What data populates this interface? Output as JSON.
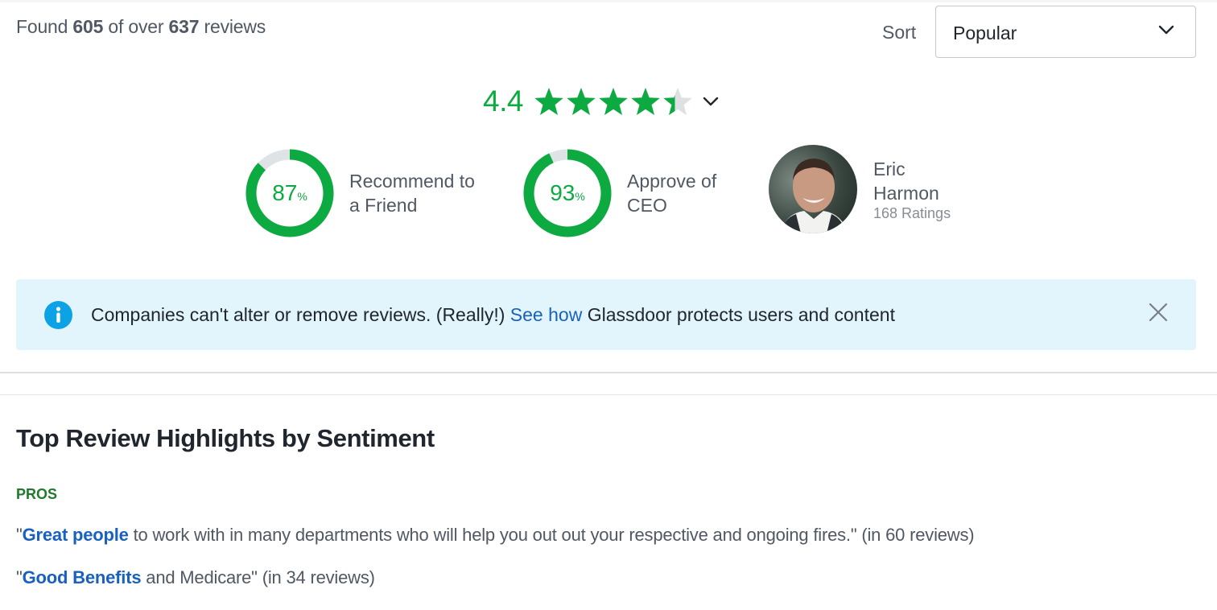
{
  "results": {
    "prefix": "Found",
    "found_count": "605",
    "middle": "of over",
    "total_count": "637",
    "suffix": "reviews"
  },
  "sort": {
    "label": "Sort",
    "selected": "Popular",
    "icon": "chevron-down-icon"
  },
  "rating": {
    "value": "4.4",
    "max_stars": 5,
    "score": 4.4,
    "colors": {
      "filled": "#0caa41",
      "empty": "#dee0e3"
    },
    "expand_icon": "chevron-down-icon"
  },
  "stats": [
    {
      "percent": 87,
      "number": "87",
      "pct_symbol": "%",
      "caption": "Recommend to a Friend"
    },
    {
      "percent": 93,
      "number": "93",
      "pct_symbol": "%",
      "caption": "Approve of CEO"
    }
  ],
  "donut_colors": {
    "filled": "#0caa41",
    "track": "#dee3e6"
  },
  "ceo": {
    "name": "Eric Harmon",
    "ratings": "168 Ratings"
  },
  "info_banner": {
    "icon": "info-icon",
    "text_before": "Companies can't alter or remove reviews. (Really!) ",
    "link": "See how",
    "text_after": " Glassdoor protects users and content",
    "close_icon": "close-icon",
    "background": "#e2f5fd"
  },
  "highlights": {
    "title": "Top Review Highlights by Sentiment",
    "pros_label": "PROS",
    "items": [
      {
        "open_quote": "\"",
        "link": "Great people",
        "rest": " to work with in many departments who will help you out out your respective and ongoing fires.\" (in 60 reviews)"
      },
      {
        "open_quote": "\"",
        "link": "Good Benefits",
        "rest": " and Medicare\" (in 34 reviews)"
      }
    ]
  }
}
